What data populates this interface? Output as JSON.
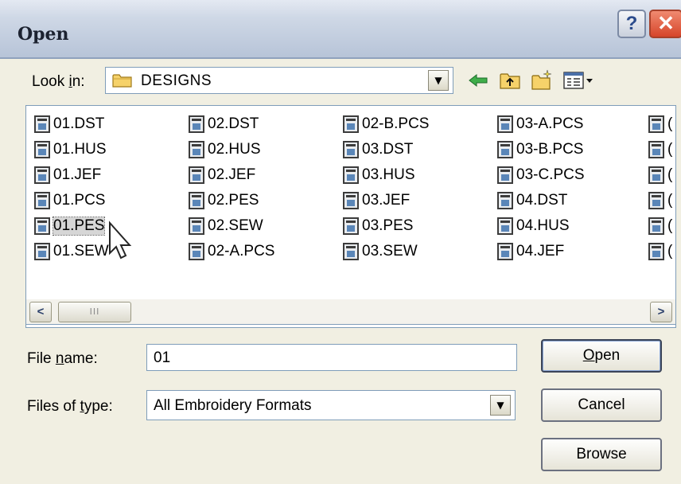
{
  "window": {
    "title": "Open",
    "help_glyph": "?",
    "close_glyph": "✕",
    "theme_color": "#c4cfe0",
    "close_color": "#d6452a"
  },
  "lookin": {
    "label_pre": "Look ",
    "label_ul": "i",
    "label_post": "n:",
    "value": "DESIGNS",
    "icon": "folder-icon"
  },
  "toolbar": {
    "icons": [
      "back-arrow-icon",
      "up-folder-icon",
      "new-folder-icon",
      "view-menu-icon"
    ]
  },
  "files": {
    "selected": "01.PES",
    "columns": [
      [
        "01.DST",
        "01.HUS",
        "01.JEF",
        "01.PCS",
        "01.PES",
        "01.SEW"
      ],
      [
        "02.DST",
        "02.HUS",
        "02.JEF",
        "02.PES",
        "02.SEW",
        "02-A.PCS"
      ],
      [
        "02-B.PCS",
        "03.DST",
        "03.HUS",
        "03.JEF",
        "03.PES",
        "03.SEW"
      ],
      [
        "03-A.PCS",
        "03-B.PCS",
        "03-C.PCS",
        "04.DST",
        "04.HUS",
        "04.JEF"
      ],
      [
        "(",
        "(",
        "(",
        "(",
        "(",
        "("
      ]
    ]
  },
  "scrollbar": {
    "left_glyph": "<",
    "right_glyph": ">",
    "thumb_grip": "III"
  },
  "filename": {
    "label_pre": "File ",
    "label_ul": "n",
    "label_post": "ame:",
    "value": "01"
  },
  "filetype": {
    "label_pre": "Files of ",
    "label_ul": "t",
    "label_post": "ype:",
    "value": "All Embroidery Formats"
  },
  "buttons": {
    "open_ul": "O",
    "open_rest": "pen",
    "cancel": "Cancel",
    "browse": "Browse"
  },
  "combo_arrow": "▼"
}
